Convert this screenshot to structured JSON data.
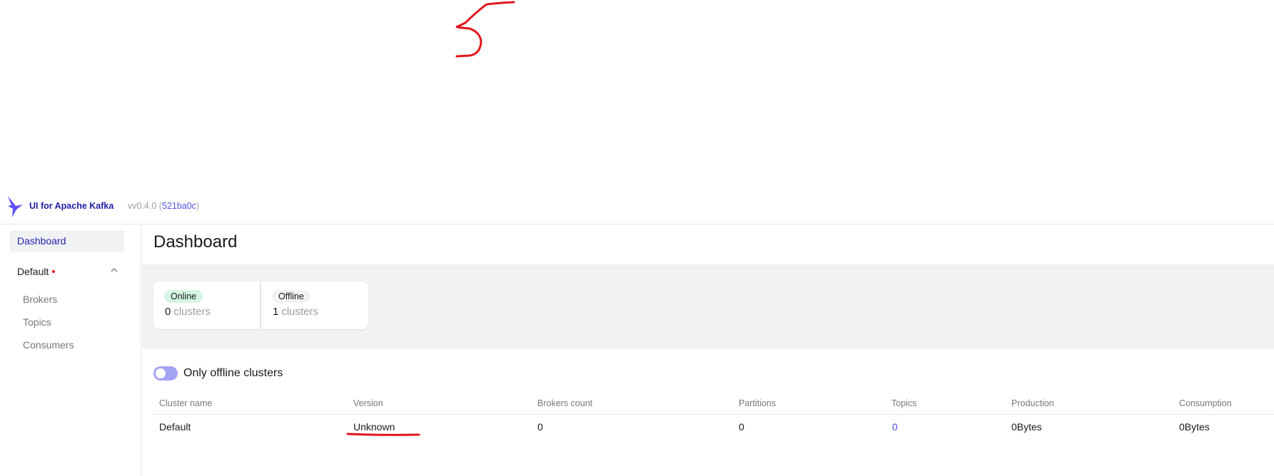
{
  "header": {
    "brand": "UI for Apache Kafka",
    "version_prefix": "vv0.4.0 (",
    "commit": "521ba0c",
    "version_suffix": ")"
  },
  "sidebar": {
    "dashboard": "Dashboard",
    "cluster": {
      "name": "Default",
      "items": [
        "Brokers",
        "Topics",
        "Consumers"
      ]
    }
  },
  "main": {
    "title": "Dashboard",
    "metrics": {
      "online": {
        "label": "Online",
        "value": "0",
        "unit": "clusters"
      },
      "offline": {
        "label": "Offline",
        "value": "1",
        "unit": "clusters"
      }
    },
    "toggle_label": "Only offline clusters",
    "table": {
      "headers": [
        "Cluster name",
        "Version",
        "Brokers count",
        "Partitions",
        "Topics",
        "Production",
        "Consumption"
      ],
      "rows": [
        [
          "Default",
          "Unknown",
          "0",
          "0",
          "0",
          "0Bytes",
          "0Bytes"
        ]
      ]
    }
  },
  "colors": {
    "accent": "#4f4fe8",
    "brand_text": "#1f1fa8",
    "online_badge": "#d6f5e3",
    "annotation_red": "#e0161b"
  },
  "icons": {
    "logo": "kafka-bird-icon",
    "chevron": "chevron-up-icon"
  }
}
